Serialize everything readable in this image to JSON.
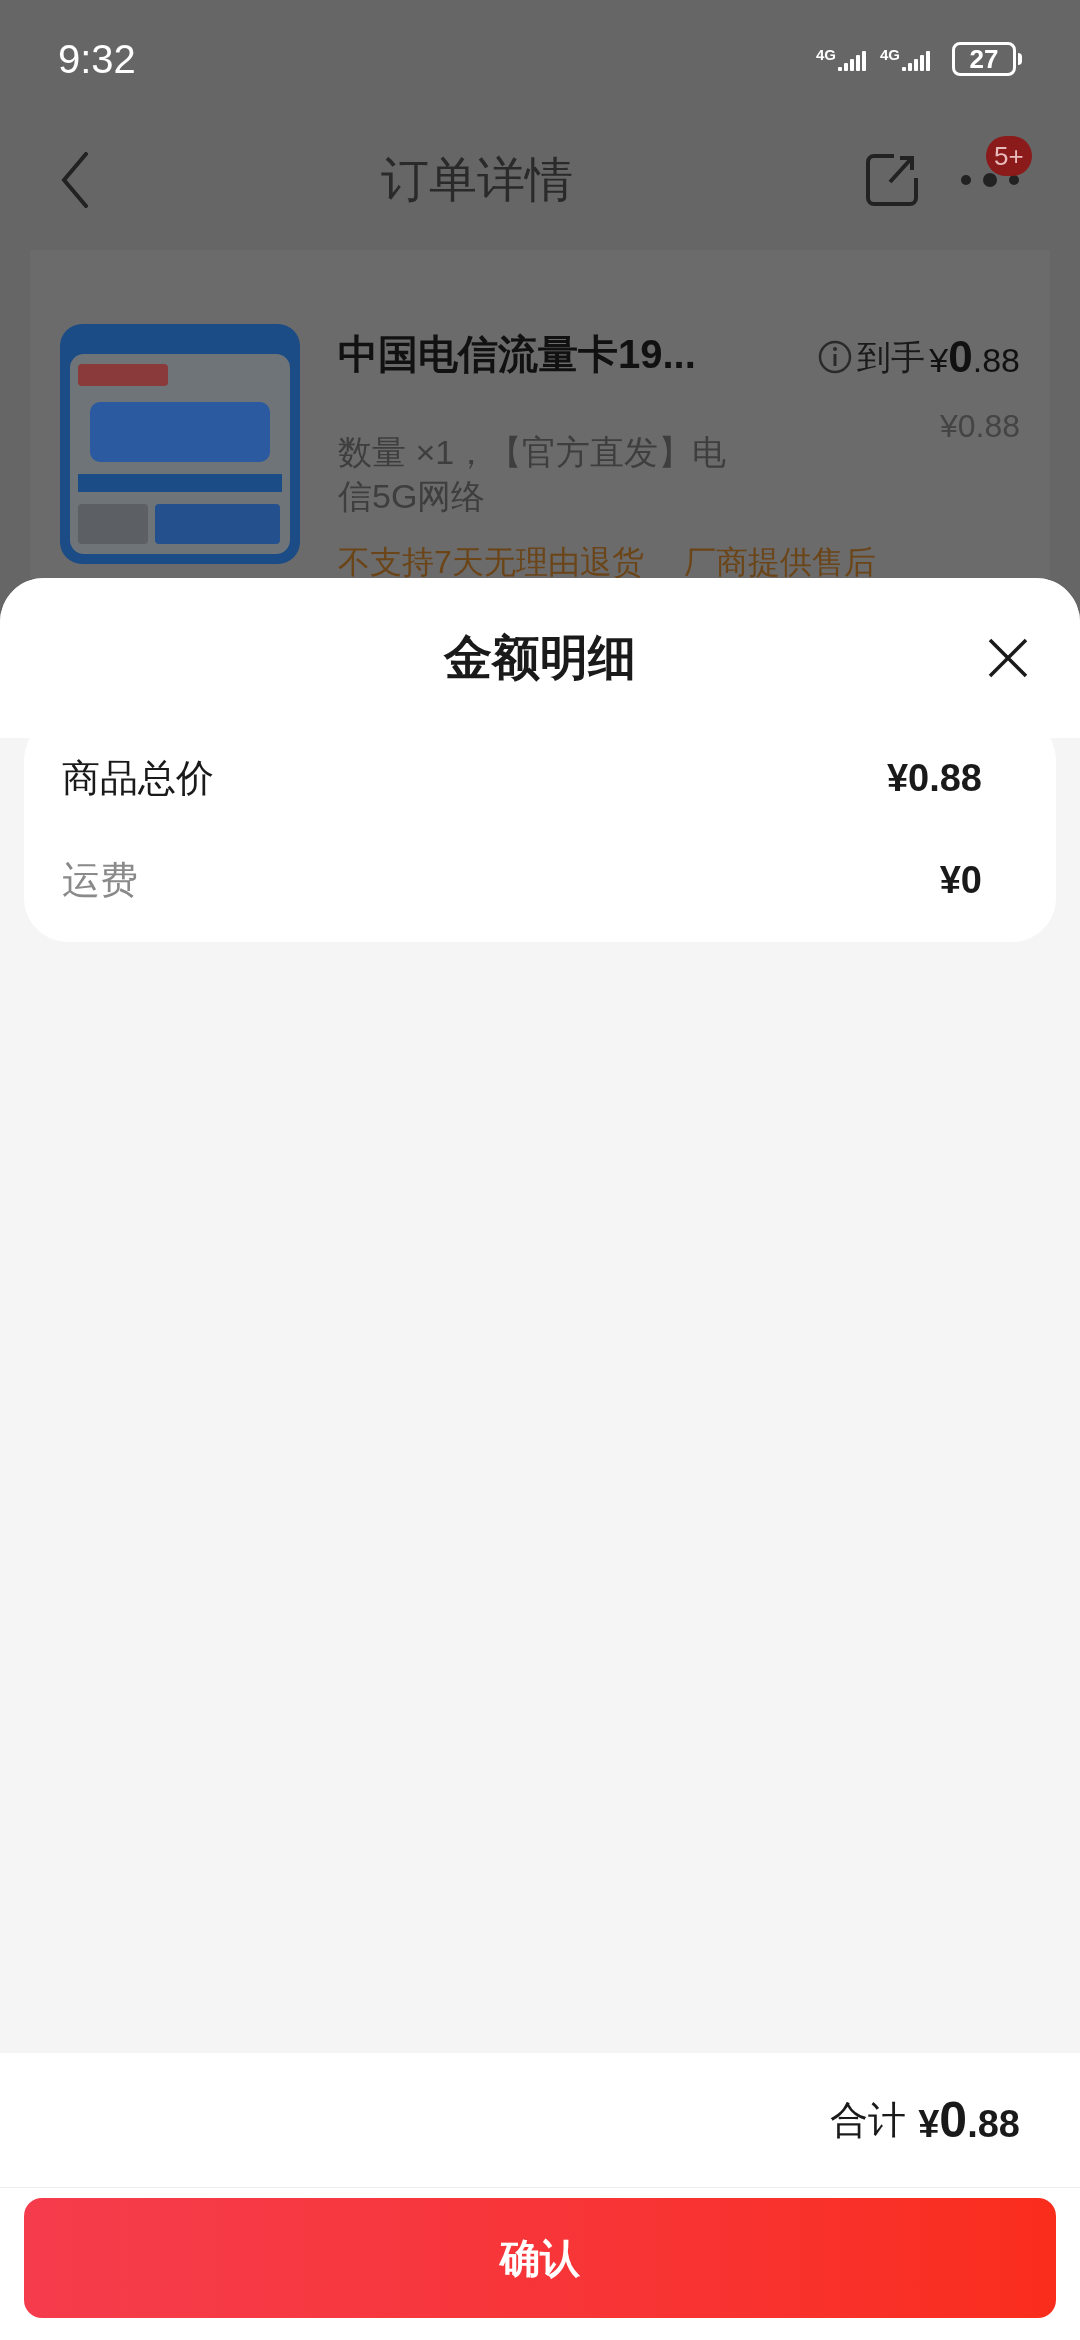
{
  "status_bar": {
    "time": "9:32",
    "battery": "27",
    "signals": [
      "4G",
      "4G"
    ]
  },
  "nav": {
    "title": "订单详情",
    "badge": "5+"
  },
  "product": {
    "title": "中国电信流量卡19...",
    "desc": "数量 ×1，【官方直发】电信5G网络",
    "price_label": "到手",
    "price": {
      "currency": "¥",
      "integer": "0",
      "decimal": ".88"
    },
    "original_price": "¥0.88",
    "notes": [
      "不支持7天无理由退货",
      "厂商提供售后"
    ]
  },
  "sheet": {
    "title": "金额明细",
    "rows": [
      {
        "label": "商品总价",
        "value": "¥0.88",
        "kind": "main"
      },
      {
        "label": "运费",
        "value": "¥0",
        "kind": "sub"
      }
    ],
    "total": {
      "label": "合计",
      "currency": "¥",
      "integer": "0",
      "decimal": ".88"
    },
    "confirm": "确认"
  }
}
